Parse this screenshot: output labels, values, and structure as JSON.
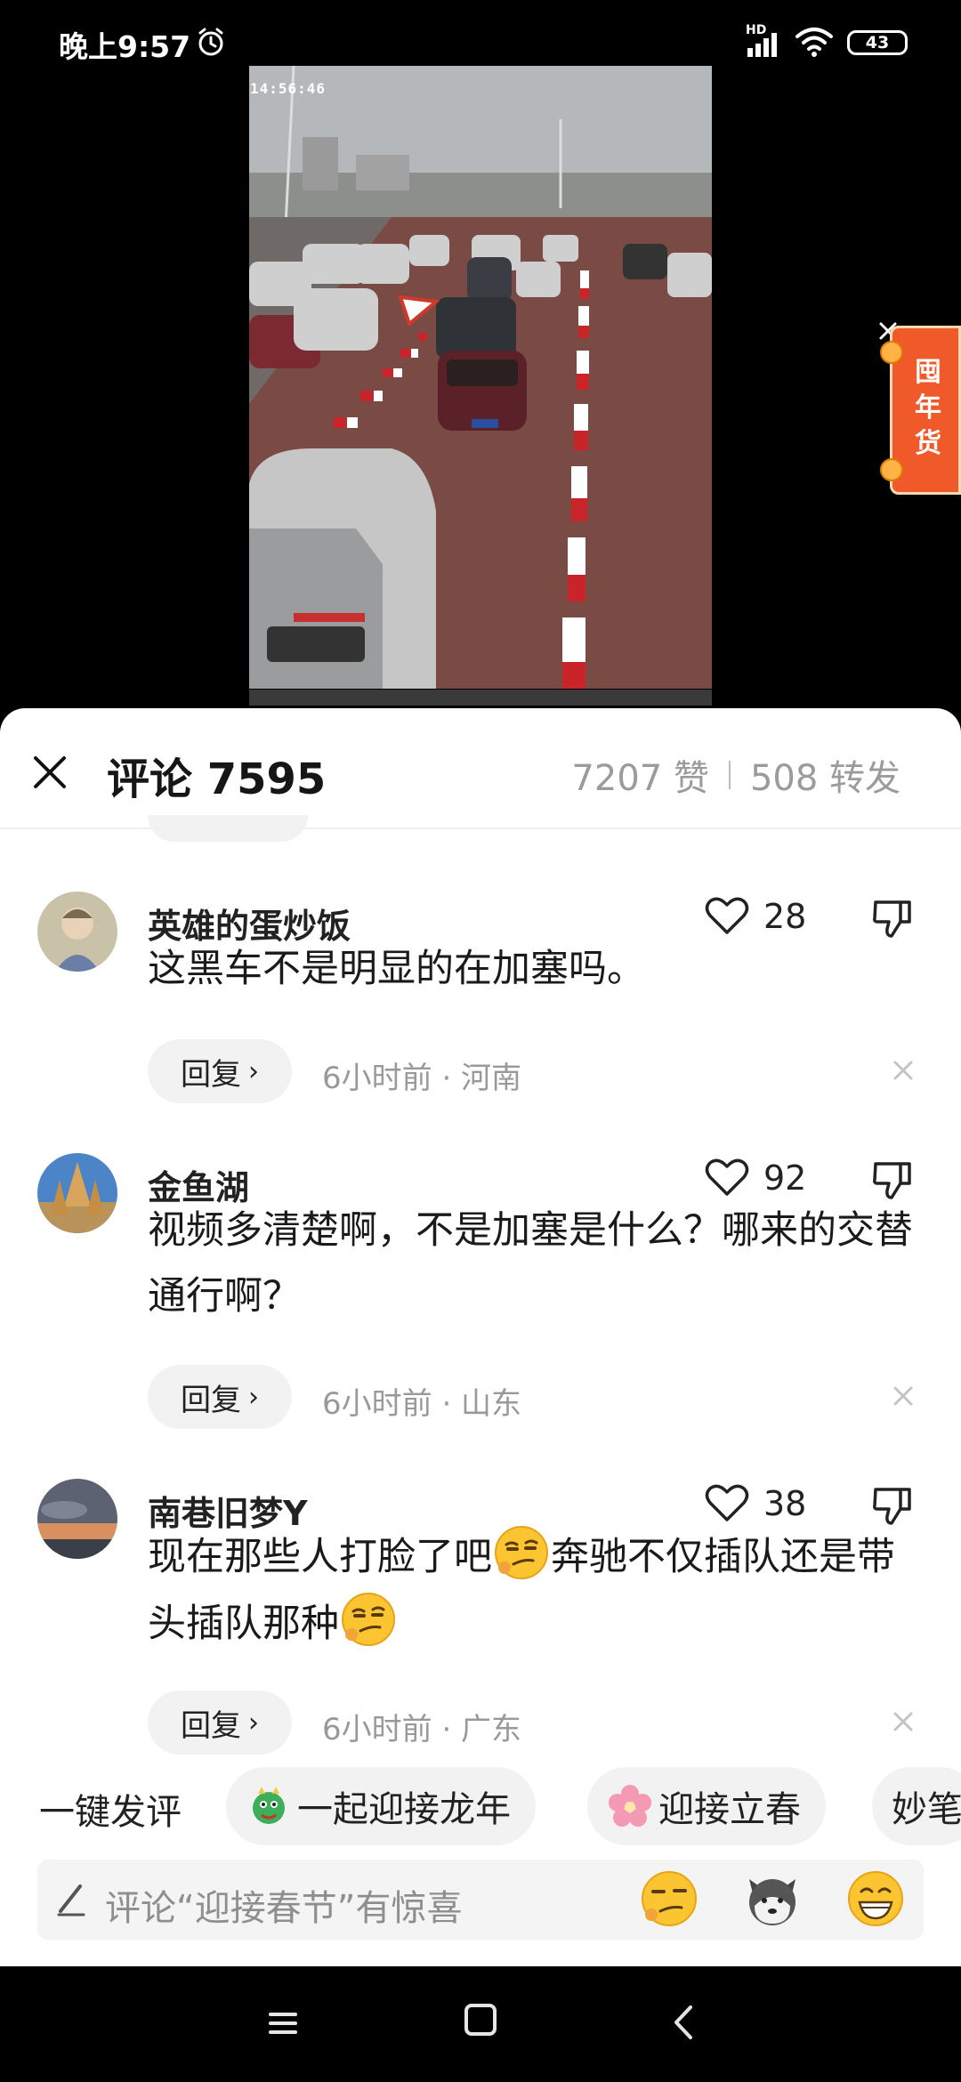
{
  "status_bar": {
    "time": "晚上9:57",
    "hd_label": "HD",
    "battery": "43",
    "icons": [
      "alarm-icon",
      "signal-icon",
      "wifi-icon",
      "battery-icon"
    ]
  },
  "video": {
    "timestamp": "14:56:46"
  },
  "promo": {
    "text": "囤年货"
  },
  "sheet": {
    "title": "评论 7595",
    "likes": "7207 赞",
    "shares": "508 转发"
  },
  "comments": [
    {
      "username": "英雄的蛋炒饭",
      "text": "这黑车不是明显的在加塞吗。",
      "likes": "28",
      "reply_label": "回复",
      "meta": "6小时前 · 河南"
    },
    {
      "username": "金鱼湖",
      "text": "视频多清楚啊，不是加塞是什么？哪来的交替通行啊？",
      "likes": "92",
      "reply_label": "回复",
      "meta": "6小时前 · 山东"
    },
    {
      "username": "南巷旧梦Y",
      "text_part1": "现在那些人打脸了吧",
      "text_part2": "奔驰不仅插队还是带头插队那种",
      "likes": "38",
      "reply_label": "回复",
      "meta": "6小时前 · 广东"
    }
  ],
  "quick_reply": {
    "label": "一键发评",
    "chips": [
      "一起迎接龙年",
      "迎接立春",
      "妙笔"
    ]
  },
  "input": {
    "placeholder": "评论“迎接春节”有惊喜"
  },
  "colors": {
    "promo": "#f05a2a",
    "chip_bg": "#f2f2f2",
    "meta_text": "#999999"
  }
}
